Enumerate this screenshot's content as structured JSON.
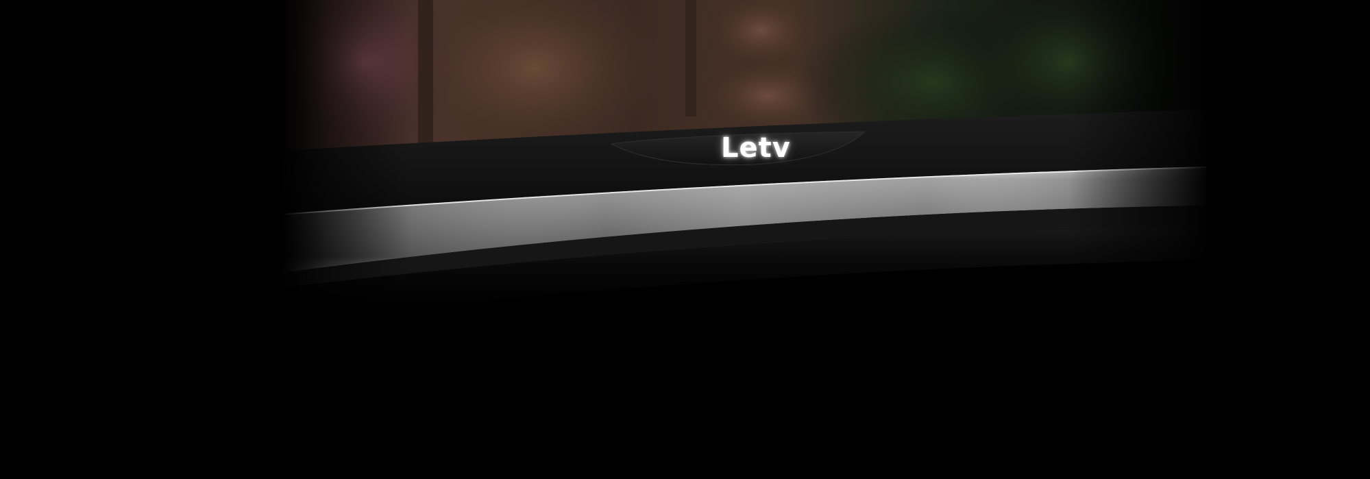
{
  "brand": {
    "logo_text": "Letv"
  },
  "scene": {
    "subject": "curved-tv-bottom-bezel",
    "colors": {
      "background": "#000000",
      "bezel": "#141414",
      "trim_light": "#bcbcbc",
      "trim_dark": "#5a5a5a",
      "logo_glow": "#ffffff"
    }
  }
}
